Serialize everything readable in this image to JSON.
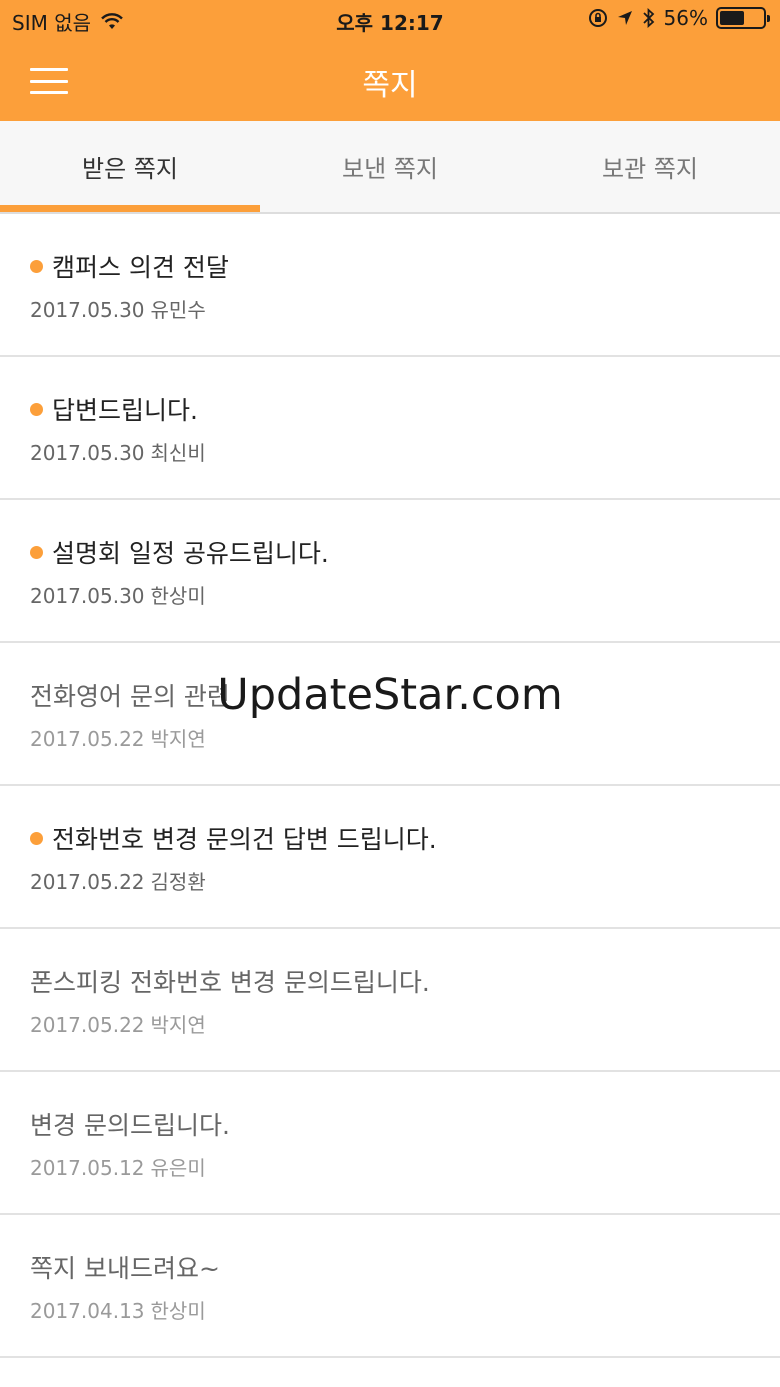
{
  "status_bar": {
    "carrier": "SIM 없음",
    "wifi_icon": "wifi-icon",
    "time": "오후 12:17",
    "battery_percent": "56%",
    "battery_level": 0.56,
    "icons": [
      "orientation-lock-icon",
      "location-arrow-icon",
      "bluetooth-icon",
      "battery-icon"
    ]
  },
  "header": {
    "menu_icon": "hamburger-menu-icon",
    "title": "쪽지"
  },
  "tabs": [
    {
      "label": "받은 쪽지",
      "active": true
    },
    {
      "label": "보낸 쪽지",
      "active": false
    },
    {
      "label": "보관 쪽지",
      "active": false
    }
  ],
  "messages": [
    {
      "title": "캠퍼스 의견 전달",
      "date": "2017.05.30",
      "sender": "유민수",
      "unread": true
    },
    {
      "title": "답변드립니다.",
      "date": "2017.05.30",
      "sender": "최신비",
      "unread": true
    },
    {
      "title": "설명회 일정 공유드립니다.",
      "date": "2017.05.30",
      "sender": "한상미",
      "unread": true
    },
    {
      "title": "전화영어 문의 관련",
      "date": "2017.05.22",
      "sender": "박지연",
      "unread": false
    },
    {
      "title": "전화번호 변경 문의건 답변 드립니다.",
      "date": "2017.05.22",
      "sender": "김정환",
      "unread": true
    },
    {
      "title": "폰스피킹 전화번호 변경 문의드립니다.",
      "date": "2017.05.22",
      "sender": "박지연",
      "unread": false
    },
    {
      "title": "변경 문의드립니다.",
      "date": "2017.05.12",
      "sender": "유은미",
      "unread": false
    },
    {
      "title": "쪽지 보내드려요~",
      "date": "2017.04.13",
      "sender": "한상미",
      "unread": false
    }
  ],
  "watermark": "UpdateStar.com",
  "colors": {
    "accent": "#fc9f3a",
    "header_text": "#ffffff",
    "unread_dot": "#fc9f3a"
  }
}
